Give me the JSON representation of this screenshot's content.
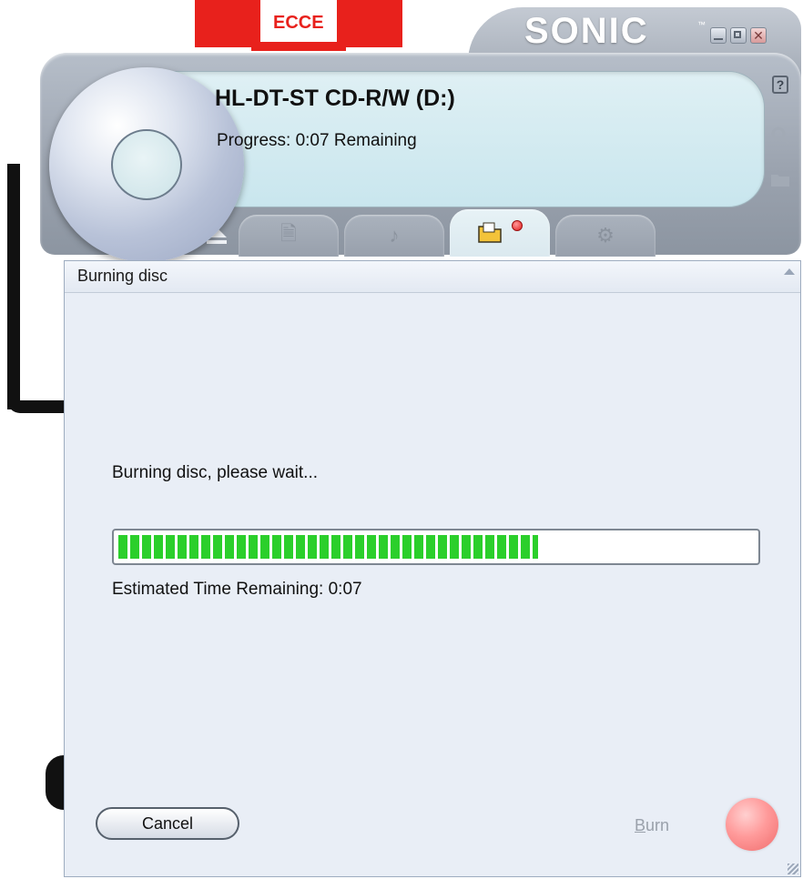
{
  "background_logo": {
    "text": "ECCE"
  },
  "app": {
    "brand": "SONIC",
    "brand_mark": "™",
    "window_controls": [
      "minimize-icon",
      "maximize-icon",
      "close-icon"
    ],
    "side_icons": [
      "help-icon",
      "search-icon",
      "folder-icon"
    ]
  },
  "device": {
    "title": "HL-DT-ST CD-R/W (D:)",
    "status": "Progress: 0:07 Remaining"
  },
  "tabs": [
    {
      "icon": "eject-icon",
      "active": false
    },
    {
      "icon": "data-icon",
      "active": false
    },
    {
      "icon": "music-icon",
      "active": false
    },
    {
      "icon": "burn-folder-icon",
      "active": true
    },
    {
      "icon": "tools-icon",
      "active": false
    }
  ],
  "panel": {
    "title": "Burning disc",
    "wait_message": "Burning disc, please wait...",
    "progress_fraction": 0.66,
    "eta": "Estimated Time Remaining: 0:07",
    "cancel_label": "Cancel",
    "burn_label_accel": "B",
    "burn_label_rest": "urn"
  },
  "colors": {
    "progress_fill": "#2bcf2b",
    "burn_button": "#f06d6d",
    "logo_red": "#e8211c"
  }
}
